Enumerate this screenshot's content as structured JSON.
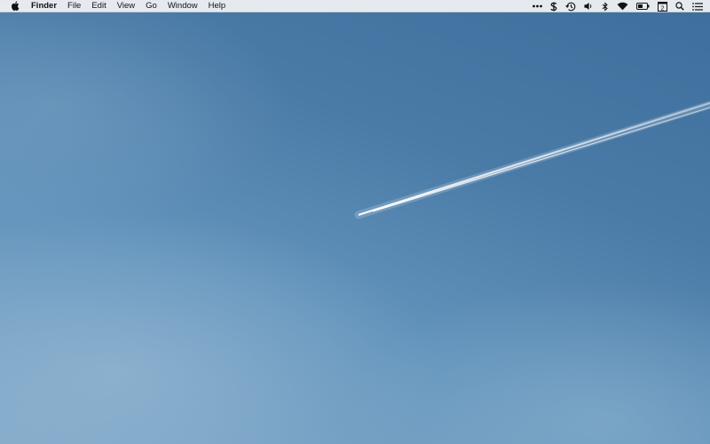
{
  "menubar": {
    "apple_icon": "apple-icon",
    "app_name": "Finder",
    "menus": [
      "File",
      "Edit",
      "View",
      "Go",
      "Window",
      "Help"
    ],
    "status_icons": [
      "more-dots-icon",
      "dollar-icon",
      "time-machine-icon",
      "volume-icon",
      "bluetooth-icon",
      "wifi-icon",
      "battery-icon",
      "calendar-icon",
      "spotlight-icon",
      "notification-center-icon"
    ],
    "calendar_day": "2"
  },
  "desktop": {
    "wallpaper": "sky-with-contrail",
    "colors": {
      "sky_top": "#3e6e9c",
      "sky_bottom": "#7fa8c8"
    }
  }
}
